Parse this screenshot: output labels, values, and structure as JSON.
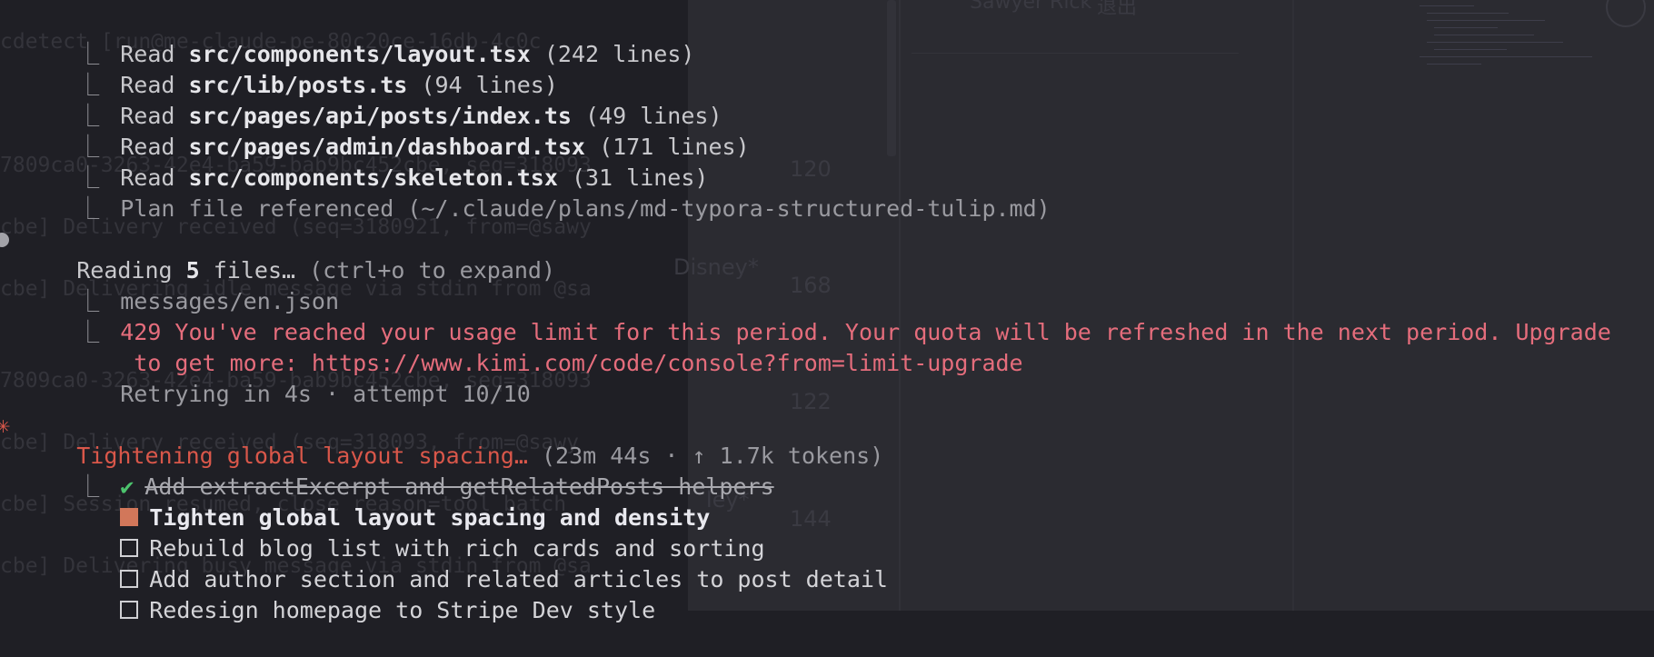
{
  "reads": [
    {
      "verb": "Read",
      "path": "src/components/layout.tsx",
      "meta": "(242 lines)"
    },
    {
      "verb": "Read",
      "path": "src/lib/posts.ts",
      "meta": "(94 lines)"
    },
    {
      "verb": "Read",
      "path": "src/pages/api/posts/index.ts",
      "meta": "(49 lines)"
    },
    {
      "verb": "Read",
      "path": "src/pages/admin/dashboard.tsx",
      "meta": "(171 lines)"
    },
    {
      "verb": "Read",
      "path": "src/components/skeleton.tsx",
      "meta": "(31 lines)"
    }
  ],
  "plan_ref": "Plan file referenced (~/.claude/plans/md-typora-structured-tulip.md)",
  "reading": {
    "prefix": "Reading ",
    "count": "5",
    "suffix": " files…",
    "hint": " (ctrl+o to expand)",
    "sub_file": "messages/en.json",
    "error_line1": "429 You've reached your usage limit for this period. Your quota will be refreshed in the next period. Upgrade",
    "error_line2": " to get more: https://www.kimi.com/code/console?from=limit-upgrade",
    "retry": "Retrying in 4s · attempt 10/10"
  },
  "status": {
    "spinner": "✳",
    "title": "Tightening global layout spacing…",
    "meta": " (23m 44s · ↑ 1.7k tokens)"
  },
  "todos": [
    {
      "state": "done",
      "text": "Add extractExcerpt and getRelatedPosts helpers"
    },
    {
      "state": "active",
      "text": "Tighten global layout spacing and density"
    },
    {
      "state": "pending",
      "text": "Rebuild blog list with rich cards and sorting"
    },
    {
      "state": "pending",
      "text": "Add author section and related articles to post detail"
    },
    {
      "state": "pending",
      "text": "Redesign homepage to Stripe Dev style"
    }
  ],
  "background": {
    "user_name": "Sawyer Rick",
    "logout": "退出",
    "numbers": [
      "120",
      "168",
      "122",
      "144"
    ],
    "disney": "Disney*",
    "ley": "ley*",
    "log1": "cdetect [run@me-claude-pe-80c20ce-16db-4c0c",
    "log2": "7809ca0-3263-42e4-ba59-bab9bc452cbe, seq=318093",
    "log3": "cbe] Delivery received (seq=3180921, from=@sawy",
    "log4": "cbe] Delivering idle message via stdin from @sa",
    "log5": "7809ca0-3263-42e4-ba59-bab9bc452cbe, seq=318093",
    "log6": "cbe] Delivery received (seq=318093, from=@sawy",
    "log7": "cbe] Session resumed, close reason=tool_batch",
    "log8": "cbe] Delivering busy message via stdin from @sa"
  },
  "colors": {
    "error": "#e56d7c",
    "success": "#4cc36d",
    "accent": "#d2775a",
    "spinner": "#d9574a"
  }
}
